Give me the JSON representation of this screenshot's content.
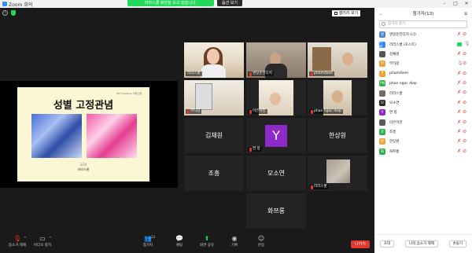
{
  "window": {
    "title": "Zoom 회의"
  },
  "banner": {
    "share_text": "라라스쿨 화면을 보고 있습니다.",
    "view_options": "옵션 보기"
  },
  "stage": {
    "gallery_button": "갤러리 보기"
  },
  "slide": {
    "title": "성별 고정관념",
    "credit": "PPT made by 라라스쿨",
    "page": "2/24",
    "subtitle": "라라스쿨"
  },
  "tiles": [
    {
      "name": "라라스쿨",
      "muted": false
    },
    {
      "name": "명랑운전다지",
      "muted": true
    },
    {
      "name": "phamdiem",
      "muted": true
    },
    {
      "name": "무타랑",
      "muted": true
    },
    {
      "name": "이은미진",
      "muted": true
    },
    {
      "name": "phan ngoc diep",
      "muted": true
    },
    {
      "name": "김채원",
      "muted": true
    },
    {
      "name": "연 봉",
      "muted": true,
      "avatar": "Y"
    },
    {
      "name": "한상원",
      "muted": true
    },
    {
      "name": "조흥",
      "muted": true
    },
    {
      "name": "모소연",
      "muted": true
    },
    {
      "name": "라라스쿨",
      "muted": true
    },
    {
      "name": "화쯔롱",
      "muted": true
    }
  ],
  "toolbar": {
    "mute": "음소거 해제",
    "video": "비디오 중지",
    "participants": "참가자",
    "participants_count": "13",
    "chat": "채팅",
    "share": "화면 공유",
    "record": "기록",
    "reactions": "반응",
    "leave": "나가기"
  },
  "panel": {
    "title": "참가자(13)",
    "search_placeholder": "참가자 찾기",
    "participants": [
      {
        "name": "명랑운전다지 (나)",
        "avatar": "명",
        "color": "#4a86c5",
        "mic": "off",
        "cam": "off"
      },
      {
        "name": "라라스쿨 (호스트)",
        "avatar": "스쿨",
        "color": "#2d8cff",
        "mic": "on",
        "cam": "on"
      },
      {
        "name": "김채원",
        "avatar": "",
        "color": "#555555",
        "mic": "off",
        "cam": "off"
      },
      {
        "name": "무타랑",
        "avatar": "무",
        "color": "#e8a33d",
        "mic": "on",
        "cam": "off"
      },
      {
        "name": "phamdiem",
        "avatar": "P",
        "color": "#e8a33d",
        "mic": "off",
        "cam": "off"
      },
      {
        "name": "phan ngoc diep",
        "avatar": "PN",
        "color": "#2fae4d",
        "mic": "off",
        "cam": "off"
      },
      {
        "name": "라라스쿨",
        "avatar": "",
        "color": "#776a5c",
        "mic": "off",
        "cam": "off"
      },
      {
        "name": "모소연",
        "avatar": "모",
        "color": "#2b2b2b",
        "mic": "off",
        "cam": "off"
      },
      {
        "name": "연 봉",
        "avatar": "Y",
        "color": "#8e2ac9",
        "mic": "off",
        "cam": "off"
      },
      {
        "name": "이은미진",
        "avatar": "",
        "color": "#5a5a5a",
        "mic": "off",
        "cam": "off"
      },
      {
        "name": "조흥",
        "avatar": "조",
        "color": "#2fae4d",
        "mic": "off",
        "cam": "off"
      },
      {
        "name": "한상원",
        "avatar": "한",
        "color": "#e8a33d",
        "mic": "off",
        "cam": "off"
      },
      {
        "name": "화쯔롱",
        "avatar": "화",
        "color": "#2fae4d",
        "mic": "off",
        "cam": "off"
      }
    ],
    "invite": "초대",
    "unmute_me": "나의 음소거 해제",
    "more": "손들기"
  }
}
